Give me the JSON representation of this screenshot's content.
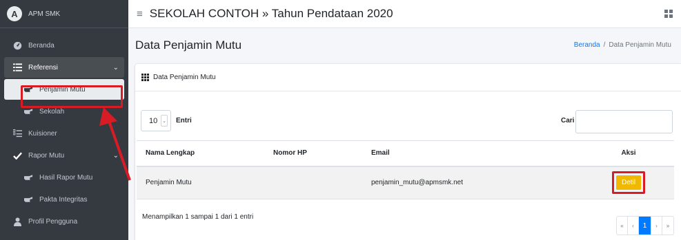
{
  "brand": {
    "logo_letter": "A",
    "name": "APM SMK"
  },
  "sidebar": {
    "items": [
      {
        "label": "Beranda",
        "icon": "dashboard-icon"
      },
      {
        "label": "Referensi",
        "icon": "list-icon"
      },
      {
        "label": "Penjamin Mutu",
        "icon": "hand-point-right-icon"
      },
      {
        "label": "Sekolah",
        "icon": "hand-point-right-icon"
      },
      {
        "label": "Kuisioner",
        "icon": "tasks-icon"
      },
      {
        "label": "Rapor Mutu",
        "icon": "check-icon"
      },
      {
        "label": "Hasil Rapor Mutu",
        "icon": "hand-point-right-icon"
      },
      {
        "label": "Pakta Integritas",
        "icon": "hand-point-right-icon"
      },
      {
        "label": "Profil Pengguna",
        "icon": "user-icon"
      }
    ]
  },
  "topbar": {
    "title": "SEKOLAH CONTOH » Tahun Pendataan 2020"
  },
  "header": {
    "page_title": "Data Penjamin Mutu",
    "breadcrumb_home": "Beranda",
    "breadcrumb_sep": "/",
    "breadcrumb_current": "Data Penjamin Mutu"
  },
  "card": {
    "title": "Data Penjamin Mutu",
    "length_value": "10",
    "length_label": "Entri",
    "search_label": "Cari",
    "columns": [
      "Nama Lengkap",
      "Nomor HP",
      "Email",
      "Aksi"
    ],
    "rows": [
      {
        "nama": "Penjamin Mutu",
        "hp": "",
        "email": "penjamin_mutu@apmsmk.net",
        "aksi": "Detil"
      }
    ],
    "info": "Menampilkan 1 sampai 1 dari 1 entri",
    "pager": {
      "first": "«",
      "prev": "‹",
      "current": "1",
      "next": "›",
      "last": "»"
    }
  },
  "colors": {
    "sidebar_bg": "#343a40",
    "highlight": "#d81b25",
    "button_warning": "#f0b800",
    "pager_active": "#007bff"
  }
}
